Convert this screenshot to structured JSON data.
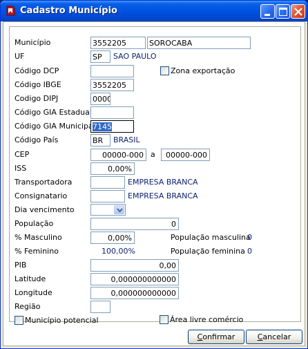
{
  "window": {
    "title": "Cadastro Município",
    "icon": "app-red-icon",
    "controls": [
      "minimize-icon",
      "maximize-icon",
      "close-icon"
    ]
  },
  "form": {
    "municipio": {
      "label": "Município",
      "codigo": "3552205",
      "nome": "SOROCABA"
    },
    "uf": {
      "label": "UF",
      "sigla": "SP",
      "nome": "SAO PAULO"
    },
    "codigo_dcp": {
      "label": "Código DCP",
      "value": ""
    },
    "zona_exportacao": {
      "label": "Zona exportação",
      "checked": false
    },
    "codigo_ibge": {
      "label": "Código IBGE",
      "value": "3552205"
    },
    "codigo_dipj": {
      "label": "Codigo DIPJ",
      "value": "0000"
    },
    "codigo_gia_estadual": {
      "label": "Código GIA Estadual",
      "value": ""
    },
    "codigo_gia_municipal": {
      "label": "Código GIA Municipal",
      "value": "7145"
    },
    "codigo_pais": {
      "label": "Código País",
      "sigla": "BR",
      "nome": "BRASIL"
    },
    "cep": {
      "label": "CEP",
      "from": "00000-000",
      "separator": "a",
      "to": "00000-000"
    },
    "iss": {
      "label": "ISS",
      "value": "0,00%"
    },
    "transportadora": {
      "label": "Transportadora",
      "codigo": "",
      "nome": "EMPRESA BRANCA"
    },
    "consignatario": {
      "label": "Consignatario",
      "codigo": "",
      "nome": "EMPRESA BRANCA"
    },
    "dia_vencimento": {
      "label": "Dia vencimento",
      "value": ""
    },
    "populacao": {
      "label": "População",
      "value": "0"
    },
    "pct_masculino": {
      "label": "% Masculino",
      "value": "0,00%"
    },
    "populacao_masculina": {
      "label": "População masculina",
      "value": "0"
    },
    "pct_feminino": {
      "label": "% Feminino",
      "value": "100,00%"
    },
    "populacao_feminina": {
      "label": "População feminina",
      "value": "0"
    },
    "pib": {
      "label": "PIB",
      "value": "0,00"
    },
    "latitude": {
      "label": "Latitude",
      "value": "0,000000000000"
    },
    "longitude": {
      "label": "Longitude",
      "value": "0,000000000000"
    },
    "regiao": {
      "label": "Região",
      "value": ""
    },
    "municipio_potencial": {
      "label": "Município potencial",
      "checked": false
    },
    "area_livre_comercio": {
      "label": "Área livre comércio",
      "checked": false
    }
  },
  "buttons": {
    "confirmar": {
      "label_prefix": "",
      "label_key": "C",
      "label_rest": "onfirmar"
    },
    "cancelar": {
      "label_prefix": "",
      "label_key": "C",
      "label_rest": "ancelar"
    }
  }
}
